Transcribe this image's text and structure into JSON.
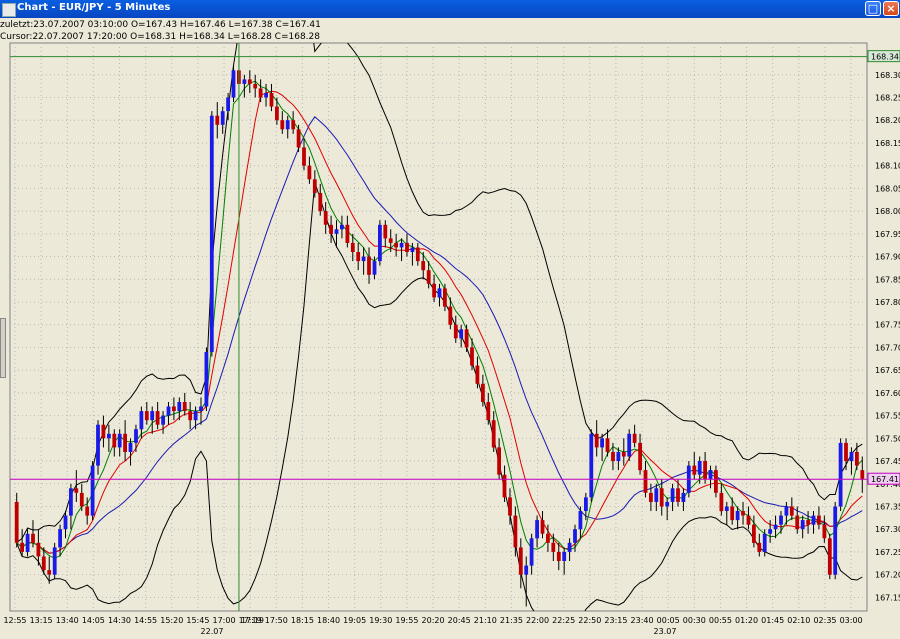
{
  "window": {
    "title": "Chart - EUR/JPY - 5 Minutes",
    "maximize_icon": "maximize-icon",
    "close_icon": "close-icon"
  },
  "header": {
    "last_bar": "zuletzt:23.07.2007 03:10:00 O=167.43 H=167.46 L=167.38 C=167.41",
    "cursor_bar": "Cursor:22.07.2007 17:20:00 O=168.31 H=168.34 L=168.28 C=168.28"
  },
  "colors": {
    "background": "#ece9d8",
    "bull": "#1a1ae6",
    "bear": "#c00000",
    "ma_green": "#008000",
    "ma_red": "#e00000",
    "ma_blue": "#1a1ab3",
    "band": "#000000",
    "cursor_price_line": "#c000c0",
    "crosshair": "#2e8b2e"
  },
  "chart_data": {
    "type": "candlestick",
    "symbol": "EUR/JPY",
    "timeframe": "5 Minutes",
    "yticks": [
      "168.30",
      "168.25",
      "168.20",
      "168.15",
      "168.10",
      "168.05",
      "168.00",
      "167.95",
      "167.90",
      "167.85",
      "167.80",
      "167.75",
      "167.70",
      "167.65",
      "167.60",
      "167.55",
      "167.50",
      "167.45",
      "167.40",
      "167.35",
      "167.30",
      "167.25",
      "167.20",
      "167.15"
    ],
    "ylim": [
      167.12,
      168.37
    ],
    "xticks": [
      "12:55",
      "13:15",
      "13:40",
      "14:05",
      "14:30",
      "14:55",
      "15:20",
      "15:45",
      "17:00",
      "17:19",
      "17:50",
      "18:15",
      "18:40",
      "19:05",
      "19:30",
      "19:55",
      "20:20",
      "20:45",
      "21:10",
      "21:35",
      "22:00",
      "22:25",
      "22:50",
      "23:15",
      "23:40",
      "00:05",
      "00:30",
      "00:55",
      "01:20",
      "01:45",
      "02:10",
      "02:35",
      "03:00"
    ],
    "date_labels": [
      "22.07",
      "23.07"
    ],
    "price_markers": {
      "high": "168.34",
      "current": "167.41"
    },
    "crosshair_price": 168.34,
    "current_price": 167.41,
    "bar_count": 188,
    "ohlc": [
      [
        167.36,
        167.38,
        167.26,
        167.27
      ],
      [
        167.27,
        167.3,
        167.24,
        167.25
      ],
      [
        167.25,
        167.3,
        167.24,
        167.29
      ],
      [
        167.29,
        167.32,
        167.26,
        167.27
      ],
      [
        167.27,
        167.3,
        167.22,
        167.24
      ],
      [
        167.24,
        167.26,
        167.2,
        167.21
      ],
      [
        167.21,
        167.24,
        167.18,
        167.2
      ],
      [
        167.2,
        167.27,
        167.19,
        167.26
      ],
      [
        167.26,
        167.31,
        167.24,
        167.3
      ],
      [
        167.3,
        167.34,
        167.28,
        167.33
      ],
      [
        167.33,
        167.4,
        167.3,
        167.39
      ],
      [
        167.39,
        167.43,
        167.36,
        167.38
      ],
      [
        167.38,
        167.4,
        167.34,
        167.35
      ],
      [
        167.35,
        167.37,
        167.31,
        167.33
      ],
      [
        167.33,
        167.45,
        167.32,
        167.44
      ],
      [
        167.44,
        167.54,
        167.42,
        167.53
      ],
      [
        167.53,
        167.55,
        167.48,
        167.5
      ],
      [
        167.5,
        167.53,
        167.47,
        167.51
      ],
      [
        167.51,
        167.52,
        167.46,
        167.48
      ],
      [
        167.48,
        167.52,
        167.46,
        167.51
      ],
      [
        167.51,
        167.54,
        167.45,
        167.47
      ],
      [
        167.47,
        167.5,
        167.44,
        167.49
      ],
      [
        167.49,
        167.53,
        167.47,
        167.52
      ],
      [
        167.52,
        167.57,
        167.5,
        167.56
      ],
      [
        167.56,
        167.58,
        167.53,
        167.54
      ],
      [
        167.54,
        167.57,
        167.51,
        167.56
      ],
      [
        167.56,
        167.58,
        167.52,
        167.53
      ],
      [
        167.53,
        167.56,
        167.51,
        167.55
      ],
      [
        167.55,
        167.58,
        167.53,
        167.57
      ],
      [
        167.57,
        167.59,
        167.54,
        167.56
      ],
      [
        167.56,
        167.59,
        167.54,
        167.58
      ],
      [
        167.58,
        167.6,
        167.55,
        167.56
      ],
      [
        167.56,
        167.58,
        167.52,
        167.54
      ],
      [
        167.54,
        167.57,
        167.52,
        167.56
      ],
      [
        167.56,
        167.59,
        167.53,
        167.57
      ],
      [
        167.57,
        167.7,
        167.56,
        167.69
      ],
      [
        167.69,
        168.22,
        167.68,
        168.21
      ],
      [
        168.21,
        168.24,
        168.16,
        168.19
      ],
      [
        168.19,
        168.23,
        168.17,
        168.22
      ],
      [
        168.22,
        168.26,
        168.2,
        168.25
      ],
      [
        168.25,
        168.32,
        168.24,
        168.31
      ],
      [
        168.31,
        168.34,
        168.28,
        168.28
      ],
      [
        168.28,
        168.3,
        168.25,
        168.29
      ],
      [
        168.29,
        168.31,
        168.26,
        168.28
      ],
      [
        168.28,
        168.3,
        168.25,
        168.27
      ],
      [
        168.27,
        168.29,
        168.24,
        168.25
      ],
      [
        168.25,
        168.28,
        168.23,
        168.26
      ],
      [
        168.26,
        168.28,
        168.22,
        168.23
      ],
      [
        168.23,
        168.25,
        168.19,
        168.2
      ],
      [
        168.2,
        168.22,
        168.17,
        168.18
      ],
      [
        168.18,
        168.21,
        168.16,
        168.2
      ],
      [
        168.2,
        168.22,
        168.17,
        168.18
      ],
      [
        168.18,
        168.19,
        168.13,
        168.14
      ],
      [
        168.14,
        168.16,
        168.09,
        168.1
      ],
      [
        168.1,
        168.12,
        168.06,
        168.07
      ],
      [
        168.07,
        168.09,
        168.03,
        168.04
      ],
      [
        168.04,
        168.06,
        167.99,
        168.0
      ],
      [
        168.0,
        168.02,
        167.95,
        167.97
      ],
      [
        167.97,
        167.99,
        167.93,
        167.95
      ],
      [
        167.95,
        167.98,
        167.92,
        167.96
      ],
      [
        167.96,
        167.99,
        167.94,
        167.97
      ],
      [
        167.97,
        167.99,
        167.92,
        167.93
      ],
      [
        167.93,
        167.95,
        167.89,
        167.91
      ],
      [
        167.91,
        167.93,
        167.87,
        167.89
      ],
      [
        167.89,
        167.92,
        167.86,
        167.9
      ],
      [
        167.9,
        167.92,
        167.84,
        167.86
      ],
      [
        167.86,
        167.9,
        167.85,
        167.89
      ],
      [
        167.89,
        167.98,
        167.88,
        167.97
      ],
      [
        167.97,
        167.98,
        167.92,
        167.94
      ],
      [
        167.94,
        167.96,
        167.91,
        167.93
      ],
      [
        167.93,
        167.95,
        167.9,
        167.92
      ],
      [
        167.92,
        167.94,
        167.89,
        167.93
      ],
      [
        167.93,
        167.95,
        167.9,
        167.91
      ],
      [
        167.91,
        167.93,
        167.88,
        167.92
      ],
      [
        167.92,
        167.93,
        167.88,
        167.89
      ],
      [
        167.89,
        167.91,
        167.85,
        167.87
      ],
      [
        167.87,
        167.89,
        167.83,
        167.84
      ],
      [
        167.84,
        167.86,
        167.8,
        167.81
      ],
      [
        167.81,
        167.84,
        167.79,
        167.83
      ],
      [
        167.83,
        167.84,
        167.78,
        167.79
      ],
      [
        167.79,
        167.81,
        167.74,
        167.75
      ],
      [
        167.75,
        167.77,
        167.71,
        167.72
      ],
      [
        167.72,
        167.75,
        167.7,
        167.74
      ],
      [
        167.74,
        167.75,
        167.69,
        167.7
      ],
      [
        167.7,
        167.72,
        167.65,
        167.66
      ],
      [
        167.66,
        167.68,
        167.61,
        167.62
      ],
      [
        167.62,
        167.64,
        167.57,
        167.58
      ],
      [
        167.58,
        167.6,
        167.53,
        167.54
      ],
      [
        167.54,
        167.56,
        167.47,
        167.48
      ],
      [
        167.48,
        167.5,
        167.41,
        167.42
      ],
      [
        167.42,
        167.44,
        167.36,
        167.37
      ],
      [
        167.37,
        167.39,
        167.31,
        167.33
      ],
      [
        167.33,
        167.35,
        167.24,
        167.26
      ],
      [
        167.26,
        167.28,
        167.17,
        167.2
      ],
      [
        167.2,
        167.24,
        167.13,
        167.22
      ],
      [
        167.22,
        167.29,
        167.2,
        167.28
      ],
      [
        167.28,
        167.33,
        167.26,
        167.32
      ],
      [
        167.32,
        167.34,
        167.28,
        167.29
      ],
      [
        167.29,
        167.31,
        167.25,
        167.27
      ],
      [
        167.27,
        167.29,
        167.23,
        167.25
      ],
      [
        167.25,
        167.27,
        167.21,
        167.23
      ],
      [
        167.23,
        167.26,
        167.2,
        167.25
      ],
      [
        167.25,
        167.28,
        167.23,
        167.27
      ],
      [
        167.27,
        167.31,
        167.25,
        167.3
      ],
      [
        167.3,
        167.35,
        167.28,
        167.34
      ],
      [
        167.34,
        167.38,
        167.32,
        167.37
      ],
      [
        167.37,
        167.52,
        167.36,
        167.51
      ],
      [
        167.51,
        167.54,
        167.46,
        167.48
      ],
      [
        167.48,
        167.51,
        167.45,
        167.5
      ],
      [
        167.5,
        167.52,
        167.46,
        167.47
      ],
      [
        167.47,
        167.49,
        167.43,
        167.45
      ],
      [
        167.45,
        167.48,
        167.43,
        167.47
      ],
      [
        167.47,
        167.5,
        167.44,
        167.46
      ],
      [
        167.46,
        167.52,
        167.45,
        167.51
      ],
      [
        167.51,
        167.53,
        167.48,
        167.49
      ],
      [
        167.49,
        167.51,
        167.42,
        167.43
      ],
      [
        167.43,
        167.45,
        167.37,
        167.38
      ],
      [
        167.38,
        167.4,
        167.34,
        167.36
      ],
      [
        167.36,
        167.4,
        167.34,
        167.39
      ],
      [
        167.39,
        167.41,
        167.33,
        167.35
      ],
      [
        167.35,
        167.37,
        167.32,
        167.36
      ],
      [
        167.36,
        167.4,
        167.34,
        167.39
      ],
      [
        167.39,
        167.41,
        167.35,
        167.36
      ],
      [
        167.36,
        167.39,
        167.34,
        167.38
      ],
      [
        167.38,
        167.45,
        167.37,
        167.44
      ],
      [
        167.44,
        167.47,
        167.41,
        167.42
      ],
      [
        167.42,
        167.46,
        167.4,
        167.45
      ],
      [
        167.45,
        167.47,
        167.4,
        167.41
      ],
      [
        167.41,
        167.44,
        167.39,
        167.43
      ],
      [
        167.43,
        167.44,
        167.37,
        167.38
      ],
      [
        167.38,
        167.4,
        167.33,
        167.34
      ],
      [
        167.34,
        167.36,
        167.31,
        167.35
      ],
      [
        167.35,
        167.37,
        167.31,
        167.32
      ],
      [
        167.32,
        167.35,
        167.3,
        167.34
      ],
      [
        167.34,
        167.36,
        167.31,
        167.33
      ],
      [
        167.33,
        167.35,
        167.3,
        167.31
      ],
      [
        167.31,
        167.33,
        167.26,
        167.27
      ],
      [
        167.27,
        167.29,
        167.24,
        167.25
      ],
      [
        167.25,
        167.3,
        167.24,
        167.29
      ],
      [
        167.29,
        167.32,
        167.27,
        167.3
      ],
      [
        167.3,
        167.33,
        167.28,
        167.31
      ],
      [
        167.31,
        167.34,
        167.29,
        167.33
      ],
      [
        167.33,
        167.36,
        167.31,
        167.35
      ],
      [
        167.35,
        167.37,
        167.32,
        167.33
      ],
      [
        167.33,
        167.35,
        167.29,
        167.3
      ],
      [
        167.3,
        167.33,
        167.28,
        167.32
      ],
      [
        167.32,
        167.34,
        167.29,
        167.31
      ],
      [
        167.31,
        167.34,
        167.29,
        167.33
      ],
      [
        167.33,
        167.35,
        167.3,
        167.31
      ],
      [
        167.31,
        167.33,
        167.27,
        167.28
      ],
      [
        167.28,
        167.29,
        167.19,
        167.2
      ],
      [
        167.2,
        167.36,
        167.19,
        167.35
      ],
      [
        167.35,
        167.5,
        167.34,
        167.49
      ],
      [
        167.49,
        167.5,
        167.43,
        167.45
      ],
      [
        167.45,
        167.48,
        167.42,
        167.47
      ],
      [
        167.47,
        167.49,
        167.43,
        167.44
      ],
      [
        167.43,
        167.46,
        167.38,
        167.41
      ]
    ],
    "indicators": [
      {
        "type": "sma",
        "color": "green",
        "period": 5
      },
      {
        "type": "sma",
        "color": "red",
        "period": 10
      },
      {
        "type": "sma",
        "color": "blue",
        "period": 20
      },
      {
        "type": "bollinger",
        "color": "black",
        "period": 20,
        "deviations": 2
      }
    ]
  }
}
